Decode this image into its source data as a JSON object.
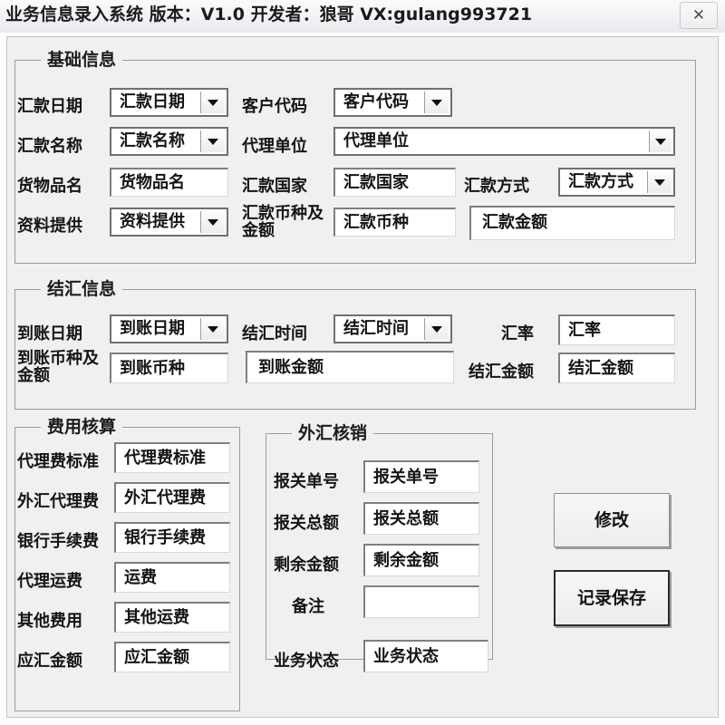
{
  "window": {
    "title": "业务信息录入系统 版本：V1.0 开发者：狼哥  VX:gulang993721",
    "close_label": "✕"
  },
  "sections": {
    "basic": {
      "title": "基础信息",
      "fields": [
        {
          "label": "汇款日期",
          "value": "汇款日期",
          "type": "combo"
        },
        {
          "label": "汇款名称",
          "value": "汇款名称",
          "type": "combo"
        },
        {
          "label": "货物品名",
          "value": "货物品名",
          "type": "text"
        },
        {
          "label": "资料提供",
          "value": "资料提供",
          "type": "combo"
        },
        {
          "label": "客户代码",
          "value": "客户代码",
          "type": "combo"
        },
        {
          "label": "代理单位",
          "value": "代理单位",
          "type": "combo"
        },
        {
          "label": "汇款国家",
          "value": "汇款国家",
          "type": "text"
        },
        {
          "label": "汇款方式",
          "value": "汇款方式",
          "type": "combo"
        },
        {
          "label": "汇款币种及金额",
          "value": "汇款币种",
          "type": "text"
        },
        {
          "label": "",
          "value": "汇款金额",
          "type": "text"
        }
      ]
    },
    "settlement": {
      "title": "结汇信息",
      "fields": [
        {
          "label": "到账日期",
          "value": "到账日期",
          "type": "combo"
        },
        {
          "label": "结汇时间",
          "value": "结汇时间",
          "type": "combo"
        },
        {
          "label": "汇率",
          "value": "汇率",
          "type": "text"
        },
        {
          "label": "到账币种及金额",
          "value": "到账币种",
          "type": "text"
        },
        {
          "label": "",
          "value": "到账金额",
          "type": "text"
        },
        {
          "label": "结汇金额",
          "value": "结汇金额",
          "type": "text"
        }
      ]
    },
    "cost": {
      "title": "费用核算",
      "fields": [
        {
          "label": "代理费标准",
          "value": "代理费标准"
        },
        {
          "label": "外汇代理费",
          "value": "外汇代理费"
        },
        {
          "label": "银行手续费",
          "value": "银行手续费"
        },
        {
          "label": "代理运费",
          "value": "运费"
        },
        {
          "label": "其他费用",
          "value": "其他运费"
        },
        {
          "label": "应汇金额",
          "value": "应汇金额"
        }
      ]
    },
    "verification": {
      "title": "外汇核销",
      "fields": [
        {
          "label": "报关单号",
          "value": "报关单号"
        },
        {
          "label": "报关总额",
          "value": "报关总额"
        },
        {
          "label": "剩余金额",
          "value": "剩余金额"
        },
        {
          "label": "备注",
          "value": ""
        }
      ]
    }
  },
  "status": {
    "label": "业务状态",
    "value": "业务状态"
  },
  "buttons": {
    "modify": "修改",
    "save": "记录保存"
  }
}
